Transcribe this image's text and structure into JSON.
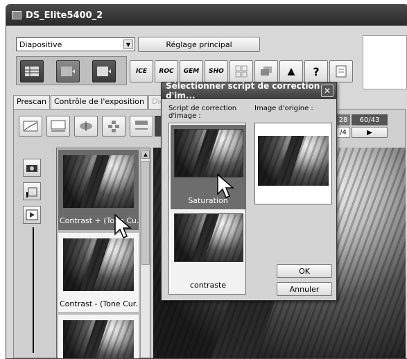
{
  "window": {
    "title": "DS_Elite5400_2"
  },
  "toolbar": {
    "film_type_selected": "Diapositive",
    "main_settings_label": "Réglage principal",
    "icons": [
      {
        "name": "index-scan-icon"
      },
      {
        "name": "prescan-icon"
      },
      {
        "name": "final-scan-icon"
      },
      {
        "name": "ice-icon",
        "label": "ICE"
      },
      {
        "name": "roc-icon",
        "label": "ROC"
      },
      {
        "name": "gem-icon",
        "label": "GEM"
      },
      {
        "name": "sho-icon",
        "label": "SHO"
      },
      {
        "name": "grid-icon"
      },
      {
        "name": "layers-icon"
      },
      {
        "name": "eject-icon",
        "label": "▲"
      },
      {
        "name": "help-icon",
        "label": "?"
      },
      {
        "name": "notes-icon"
      }
    ]
  },
  "tabs": [
    "Prescan",
    "Contrôle de l'exposition",
    "Digital"
  ],
  "side_counters": {
    "left": "28",
    "right": "60/43",
    "bottom": "/4"
  },
  "thumbnail_list": [
    {
      "caption": "Contrast + (Tone Cu..."
    },
    {
      "caption": "Contrast - (Tone Cur..."
    },
    {
      "caption": ""
    }
  ],
  "dialog": {
    "title": "Sélectionner script de correction d'im...",
    "close": "✕",
    "script_label": "Script de correction d'image :",
    "original_label": "Image d'origine :",
    "scripts": [
      {
        "caption": "Saturation",
        "selected": true
      },
      {
        "caption": "contraste",
        "selected": false
      }
    ],
    "ok": "OK",
    "cancel": "Annuler"
  }
}
